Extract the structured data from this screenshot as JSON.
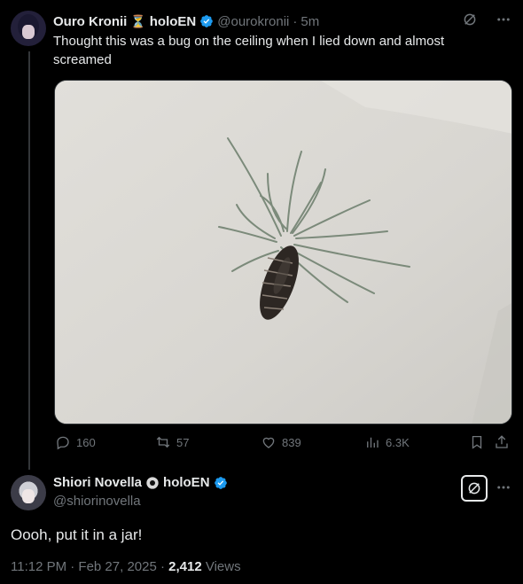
{
  "tweet": {
    "display_name": "Ouro Kronii",
    "name_emoji": "⏳",
    "name_suffix": "holoEN",
    "handle": "@ourokronii",
    "separator": "·",
    "time": "5m",
    "text": "Thought this was a bug on the ceiling when I lied down and almost screamed",
    "image_subject": "air plant on white ceiling",
    "actions": {
      "replies": "160",
      "reposts": "57",
      "likes": "839",
      "views": "6.3K"
    }
  },
  "reply": {
    "display_name": "Shiori Novella",
    "name_suffix": "holoEN",
    "handle": "@shiorinovella",
    "text": "Oooh, put it in a jar!",
    "timestamp": "11:12 PM · Feb 27, 2025 · ",
    "views_count": "2,412",
    "views_label": " Views"
  },
  "colors": {
    "background": "#000000",
    "text": "#e7e9ea",
    "muted": "#71767b",
    "verified": "#1d9bf0"
  },
  "icons": [
    "verified-badge-icon",
    "grok-icon",
    "more-icon",
    "reply-icon",
    "repost-icon",
    "like-icon",
    "views-icon",
    "bookmark-icon",
    "share-icon"
  ]
}
